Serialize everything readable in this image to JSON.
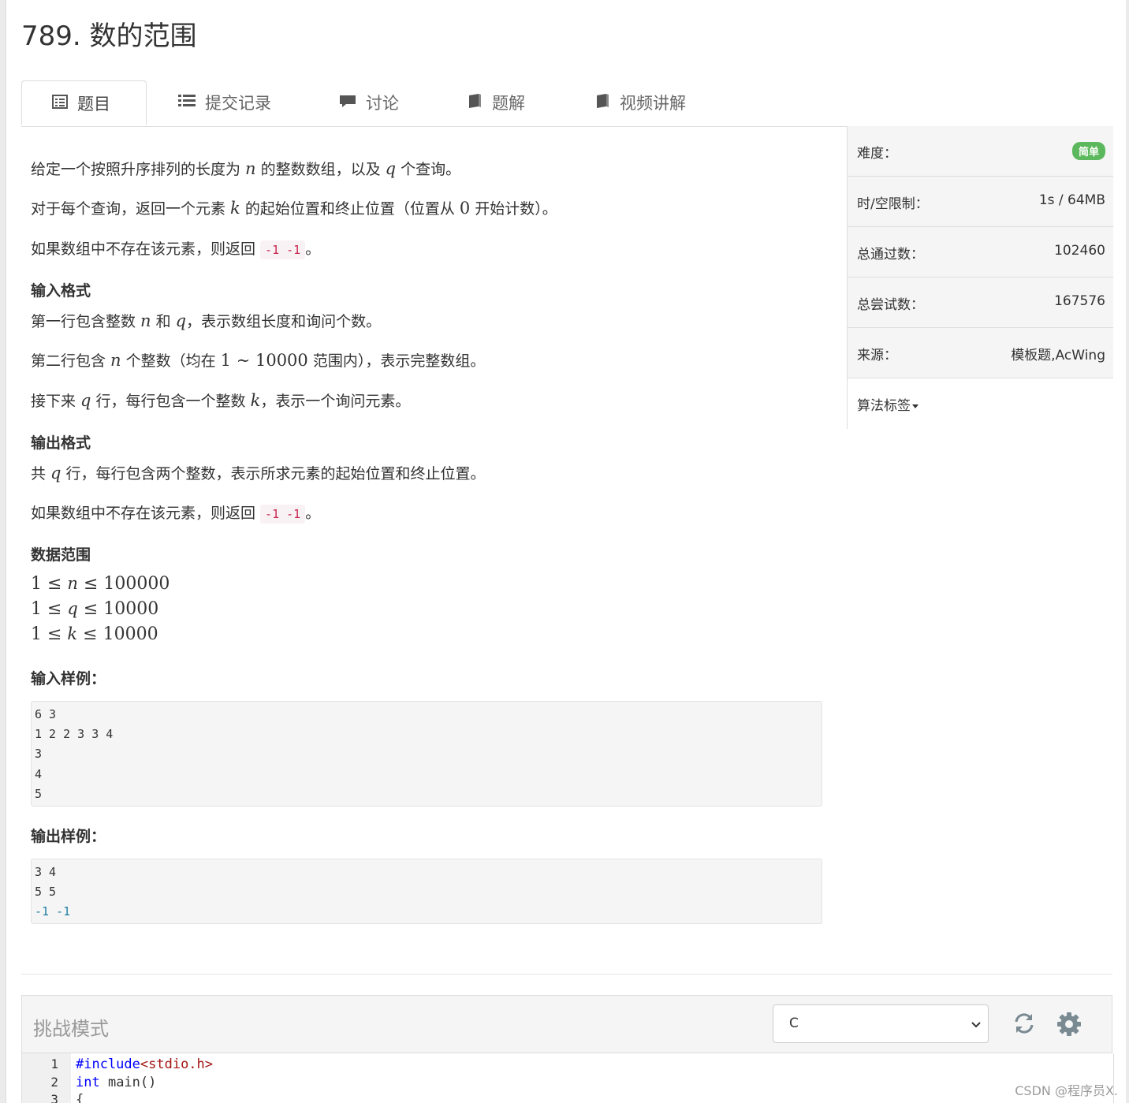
{
  "problem": {
    "title": "789. 数的范围"
  },
  "tabs": [
    {
      "label": "题目"
    },
    {
      "label": "提交记录"
    },
    {
      "label": "讨论"
    },
    {
      "label": "题解"
    },
    {
      "label": "视频讲解"
    }
  ],
  "statement": {
    "p1_a": "给定一个按照升序排列的长度为 ",
    "p1_n": "n",
    "p1_b": " 的整数数组，以及 ",
    "p1_q": "q",
    "p1_c": " 个查询。",
    "p2_a": "对于每个查询，返回一个元素 ",
    "p2_k": "k",
    "p2_b": " 的起始位置和终止位置（位置从 ",
    "p2_0": "0",
    "p2_c": " 开始计数）。",
    "p3_a": "如果数组中不存在该元素，则返回 ",
    "p3_code": "-1 -1",
    "p3_b": "。",
    "input_heading": "输入格式",
    "in1_a": "第一行包含整数 ",
    "in1_n": "n",
    "in1_b": " 和 ",
    "in1_q": "q",
    "in1_c": "，表示数组长度和询问个数。",
    "in2_a": "第二行包含 ",
    "in2_n": "n",
    "in2_b": " 个整数（均在 ",
    "in2_r": "1 ∼ 10000",
    "in2_c": " 范围内），表示完整数组。",
    "in3_a": "接下来 ",
    "in3_q": "q",
    "in3_b": " 行，每行包含一个整数 ",
    "in3_k": "k",
    "in3_c": "，表示一个询问元素。",
    "output_heading": "输出格式",
    "out1_a": "共 ",
    "out1_q": "q",
    "out1_b": " 行，每行包含两个整数，表示所求元素的起始位置和终止位置。",
    "out2_a": "如果数组中不存在该元素，则返回 ",
    "out2_code": "-1 -1",
    "out2_b": "。",
    "range_heading": "数据范围",
    "range1_a": "1 ≤ ",
    "range1_v": "n",
    "range1_b": " ≤ 100000",
    "range2_a": "1 ≤ ",
    "range2_v": "q",
    "range2_b": " ≤ 10000",
    "range3_a": "1 ≤ ",
    "range3_v": "k",
    "range3_b": " ≤ 10000",
    "sample_in_heading": "输入样例：",
    "sample_in": [
      "6 3",
      "1 2 2 3 3 4",
      "3",
      "4",
      "5"
    ],
    "sample_out_heading": "输出样例：",
    "sample_out": [
      "3 4",
      "5 5",
      "-1 -1"
    ]
  },
  "sidebar": {
    "difficulty_label": "难度：",
    "difficulty_value": "简单",
    "limit_label": "时/空限制：",
    "limit_value": "1s / 64MB",
    "accepted_label": "总通过数：",
    "accepted_value": "102460",
    "attempts_label": "总尝试数：",
    "attempts_value": "167576",
    "source_label": "来源：",
    "source_value": "模板题,AcWing",
    "tags_label": "算法标签"
  },
  "editor": {
    "mode_label": "挑战模式",
    "language": "C",
    "lines": [
      {
        "no": "1",
        "pre": "#include",
        "str": "<stdio.h>"
      },
      {
        "no": "2",
        "kw": "int",
        "rest": " main()"
      },
      {
        "no": "3",
        "rest": "{"
      }
    ]
  },
  "watermark": "CSDN @程序员X.",
  "colors": {
    "badge": "#5cb85c",
    "inline_code": "#c7254e",
    "keyword": "#0000ff"
  }
}
